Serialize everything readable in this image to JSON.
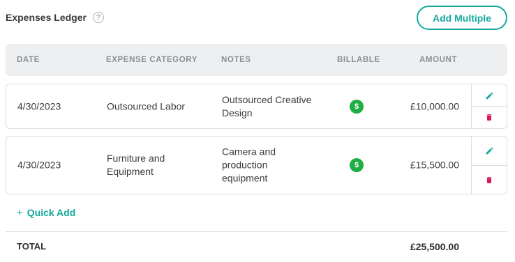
{
  "header": {
    "title": "Expenses Ledger",
    "help_icon": "?",
    "add_multiple_label": "Add Multiple"
  },
  "table": {
    "columns": {
      "date": "DATE",
      "category": "EXPENSE CATEGORY",
      "notes": "NOTES",
      "billable": "BILLABLE",
      "amount": "AMOUNT"
    },
    "rows": [
      {
        "date": "4/30/2023",
        "category": [
          "Outsourced Labor"
        ],
        "notes": [
          "Outsourced Creative",
          "Design"
        ],
        "billable": "$",
        "amount": "£10,000.00"
      },
      {
        "date": "4/30/2023",
        "category": [
          "Furniture and",
          "Equipment"
        ],
        "notes": [
          "Camera and",
          "production",
          "equipment"
        ],
        "billable": "$",
        "amount": "£15,500.00"
      }
    ]
  },
  "quick_add": {
    "plus": "+",
    "label": "Quick Add"
  },
  "footer": {
    "total_label": "TOTAL",
    "total_value": "£25,500.00"
  },
  "icons": {
    "help": "question-circle-icon",
    "billable": "dollar-circle-icon",
    "edit": "pencil-icon",
    "delete": "trash-icon"
  },
  "colors": {
    "accent": "#14a89e",
    "billable_green": "#1fae43",
    "edit_teal": "#14a89e",
    "delete_magenta": "#d6175e",
    "header_bg": "#eeeff1"
  }
}
